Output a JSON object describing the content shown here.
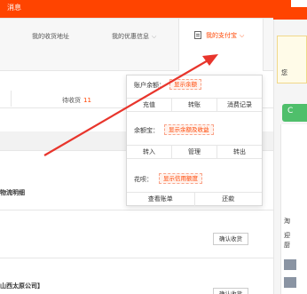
{
  "topbar": {
    "message": "消息"
  },
  "nav": {
    "address": "我的收货地址",
    "coupon": "我的优惠信息",
    "alipay": "我的支付宝"
  },
  "status": {
    "to_receive": "待收货",
    "to_receive_count": "11"
  },
  "rows": {
    "logistics": "物流明细",
    "confirm_1": "确认收货",
    "company": "山西太原公司】",
    "confirm_2": "确认收货"
  },
  "popup": {
    "balance_label": "账户余额：",
    "balance_tag": "显示余额",
    "balance_actions": [
      "充值",
      "转账",
      "消费记录"
    ],
    "yuebao_label": "余额宝：",
    "yuebao_tag": "显示余额及收益",
    "yuebao_actions": [
      "转入",
      "管理",
      "转出"
    ],
    "huabei_label": "花呗：",
    "huabei_tag": "显示信用额度",
    "huabei_actions": [
      "查看账单",
      "还款"
    ]
  },
  "side": {
    "yellow_text": "您",
    "green_text": "C",
    "lines": [
      "淘",
      "迎",
      "厨"
    ]
  },
  "colors": {
    "brand": "#ff4400",
    "arrow": "#e8352c",
    "tag_bg": "#fff3ee"
  }
}
